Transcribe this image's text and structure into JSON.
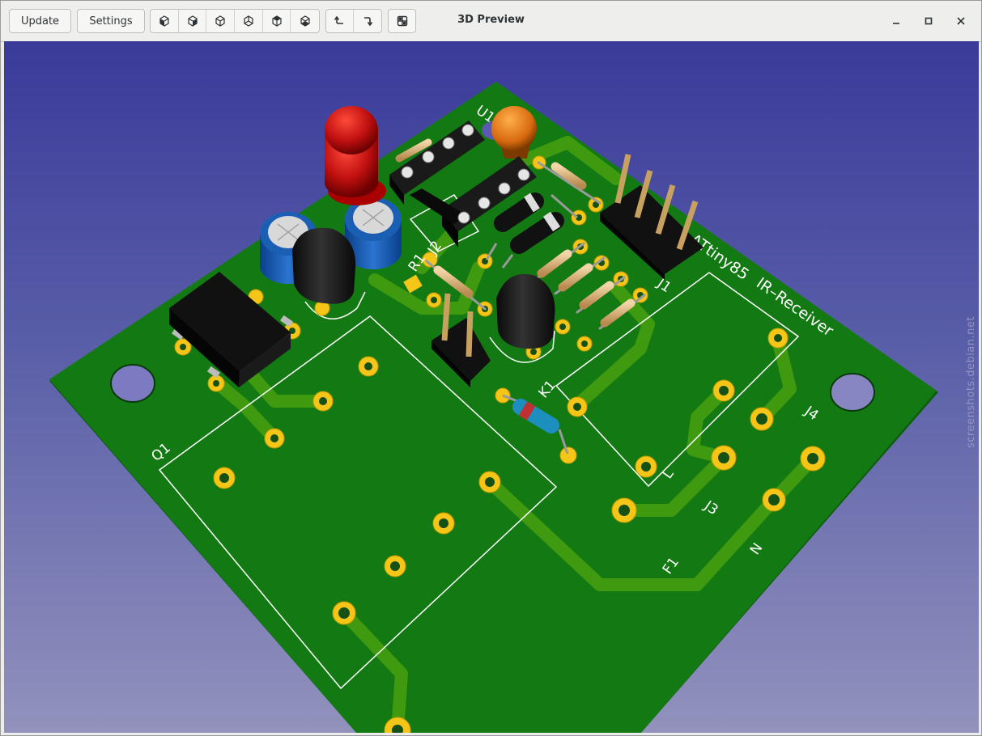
{
  "window": {
    "title": "3D Preview"
  },
  "toolbar": {
    "update_label": "Update",
    "settings_label": "Settings",
    "view_buttons": [
      "view-front-icon",
      "view-back-icon",
      "view-left-icon",
      "view-right-icon",
      "view-top-icon",
      "view-bottom-icon"
    ],
    "rotate_buttons": [
      "rotate-ccw-icon",
      "rotate-cw-icon"
    ],
    "grid_button": "grid-icon"
  },
  "board": {
    "labels": {
      "u1": "U1",
      "r1": "R1",
      "j2": "J2",
      "k1": "K1",
      "j1": "J1",
      "attiny": "ATtiny85",
      "ir": "IR–Receiver",
      "j4": "J4",
      "j3": "J3",
      "l": "L",
      "n": "N",
      "f1": "F1",
      "q1": "Q1"
    }
  },
  "watermark": "screenshots.debian.net",
  "colors": {
    "pcb": "#137a13",
    "pcb_dark": "#0e5d0e",
    "trace": "#3f9a0f",
    "pad": "#f5c518",
    "silk": "#ffffff",
    "background_top": "#3a3a9a",
    "background_bottom": "#9292bd"
  }
}
